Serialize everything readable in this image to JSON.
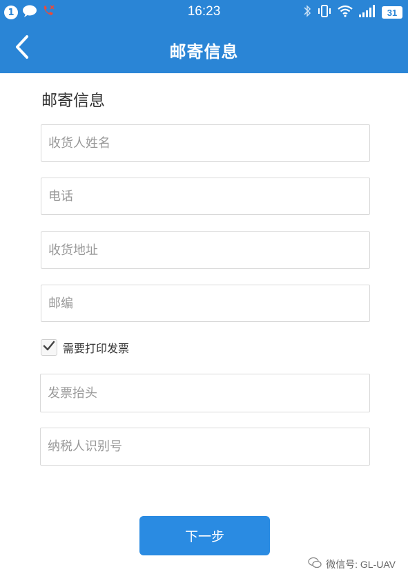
{
  "status_bar": {
    "notification_count": "1",
    "time": "16:23",
    "battery_level": "31",
    "icons": [
      "notification-badge-icon",
      "chat-bubble-icon",
      "missed-call-icon",
      "bluetooth-icon",
      "vibrate-icon",
      "wifi-icon",
      "signal-icon",
      "battery-icon"
    ]
  },
  "navbar": {
    "title": "邮寄信息",
    "back_icon": "chevron-left-icon"
  },
  "form": {
    "section_title": "邮寄信息",
    "recipient_name_placeholder": "收货人姓名",
    "phone_placeholder": "电话",
    "address_placeholder": "收货地址",
    "postcode_placeholder": "邮编",
    "print_invoice_label": "需要打印发票",
    "print_invoice_checked": true,
    "invoice_title_placeholder": "发票抬头",
    "taxpayer_id_placeholder": "纳税人识别号",
    "next_button_label": "下一步"
  },
  "watermark": {
    "text": "微信号: GL-UAV"
  },
  "colors": {
    "primary": "#2a85d6",
    "button": "#2a8be2",
    "border": "#d9d9d9",
    "placeholder": "#999999"
  }
}
